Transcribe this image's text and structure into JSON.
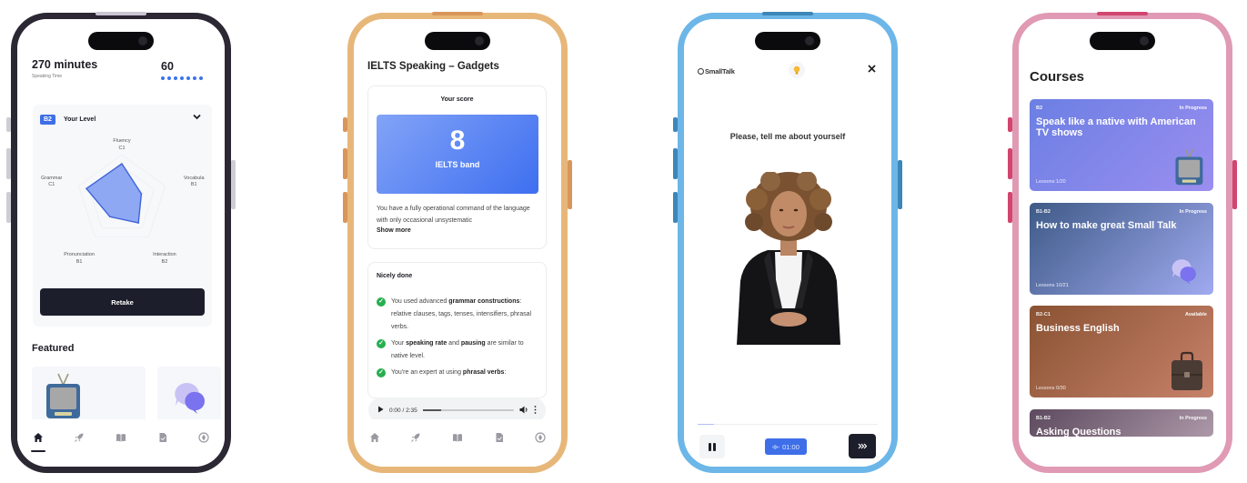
{
  "phones": {
    "home": {
      "speaking_minutes": "270 minutes",
      "speaking_label": "Speaking Time",
      "streak_value": "60",
      "streak_dots": 7,
      "level_card": {
        "badge": "B2",
        "title": "Your Level",
        "chevron": "chevron-down-icon",
        "retake_label": "Retake"
      },
      "featured_label": "Featured",
      "featured_items": [
        {
          "icon": "tv-icon"
        },
        {
          "icon": "chat-bubbles-icon"
        }
      ],
      "nav": [
        {
          "icon": "home-icon",
          "active": true
        },
        {
          "icon": "rocket-icon",
          "active": false
        },
        {
          "icon": "book-icon",
          "active": false
        },
        {
          "icon": "document-icon",
          "active": false
        },
        {
          "icon": "globe-icon",
          "active": false
        }
      ]
    },
    "ielts": {
      "title": "IELTS Speaking – Gadgets",
      "score_label": "Your score",
      "score_value": "8",
      "score_unit": "IELTS band",
      "score_description": "You have a fully operational command of the language with only occasional unsystematic",
      "show_more": "Show more",
      "nicely_done_title": "Nicely done",
      "feedback": [
        {
          "parts": [
            [
              "You used advanced ",
              false
            ],
            [
              "grammar constructions",
              true
            ],
            [
              ": relative clauses, tags, tenses, intensifiers, phrasal verbs.",
              false
            ]
          ]
        },
        {
          "parts": [
            [
              "Your ",
              false
            ],
            [
              "speaking rate",
              true
            ],
            [
              " and ",
              false
            ],
            [
              "pausing",
              true
            ],
            [
              " are similar to native level.",
              false
            ]
          ]
        },
        {
          "parts": [
            [
              "You're an expert at using ",
              false
            ],
            [
              "phrasal verbs",
              true
            ],
            [
              ":",
              false
            ]
          ]
        }
      ],
      "audio": {
        "time": "0:00 / 2:35",
        "progress": 0.2
      },
      "nav": [
        {
          "icon": "home-icon"
        },
        {
          "icon": "rocket-icon"
        },
        {
          "icon": "book-icon"
        },
        {
          "icon": "document-icon"
        },
        {
          "icon": "globe-icon"
        }
      ]
    },
    "conversation": {
      "brand": "SmallTalk",
      "hint_icon": "lightbulb-icon",
      "close_icon": "close-icon",
      "prompt": "Please, tell me about yourself",
      "progress": 0.09,
      "timer": "01:00",
      "pause_icon": "pause-icon",
      "next_icon": "skip-forward-icon"
    },
    "courses": {
      "title": "Courses",
      "items": [
        {
          "level": "B2",
          "status": "In Progress",
          "title": "Speak like a native with American TV shows",
          "lessons": "Lessons 1/20",
          "icon": "tv-icon"
        },
        {
          "level": "B1-B2",
          "status": "In Progress",
          "title": "How to make great Small Talk",
          "lessons": "Lessons 10/21",
          "icon": "chat-bubbles-icon"
        },
        {
          "level": "B2-C1",
          "status": "Available",
          "title": "Business English",
          "lessons": "Lessons 0/30",
          "icon": "briefcase-icon"
        },
        {
          "level": "B1-B2",
          "status": "In Progress",
          "title": "Asking Questions",
          "lessons": "",
          "icon": ""
        }
      ]
    }
  },
  "chart_data": {
    "type": "radar",
    "title": "Your Level",
    "axes": [
      "Fluency",
      "Vocabulary",
      "Interaction",
      "Pronunciation",
      "Grammar"
    ],
    "axis_labels": [
      "Fluency",
      "Vocabula",
      "Interaction",
      "Pronunciation",
      "Grammar"
    ],
    "levels": [
      "C1",
      "B1",
      "B2",
      "B1",
      "C1"
    ],
    "scale": [
      "A1",
      "A2",
      "B1",
      "B2",
      "C1",
      "C2"
    ],
    "values": [
      0.8,
      0.45,
      0.62,
      0.45,
      0.82
    ]
  },
  "colors": {
    "accent": "#3e6fe6",
    "dark_button": "#1d1e2b",
    "success": "#27ae4f",
    "frame_home": "#2b2733",
    "frame_ielts": "#e7b77a",
    "frame_conversation": "#6cb6e8",
    "frame_courses": "#e09ab3"
  }
}
